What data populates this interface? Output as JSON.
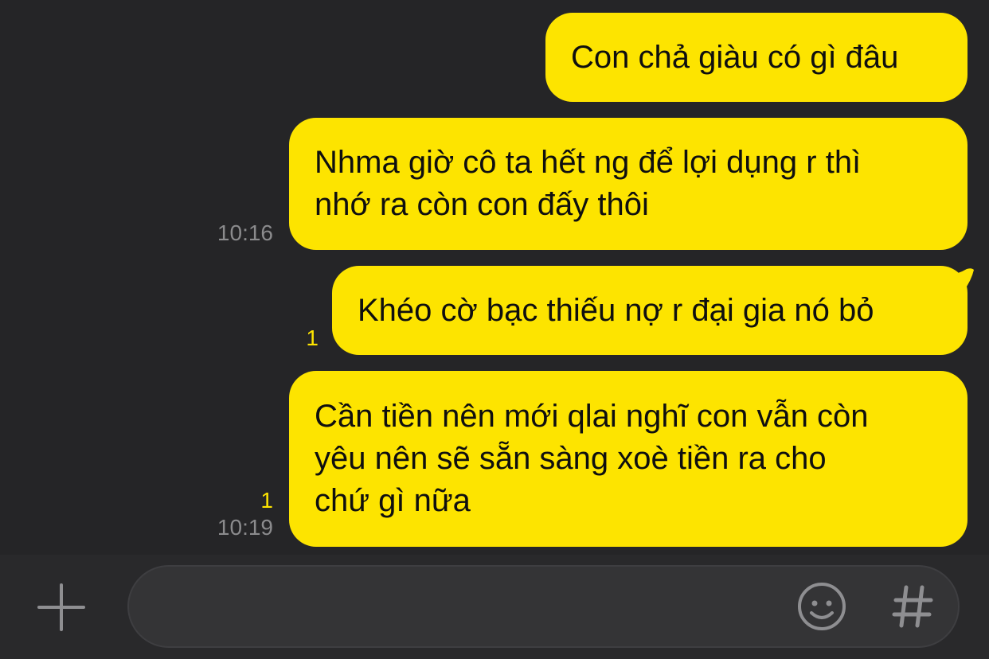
{
  "colors": {
    "background": "#252527",
    "bubble_outgoing": "#fde400",
    "bubble_text": "#0f0f0f",
    "timestamp": "#8b8b8d",
    "unread_count": "#fde400",
    "composer_bar": "#29292b",
    "input_field": "#343436",
    "icon": "#8e8e91"
  },
  "messages": [
    {
      "lines": [
        "Con chả giàu có gì đâu"
      ],
      "unread": "",
      "time": ""
    },
    {
      "lines": [
        "Nhma giờ cô ta hết ng để lợi dụng r thì",
        "nhớ ra còn con đấy thôi"
      ],
      "unread": "",
      "time": "10:16"
    },
    {
      "lines": [
        "Khéo cờ bạc thiếu nợ r đại gia nó bỏ"
      ],
      "unread": "1",
      "time": ""
    },
    {
      "lines": [
        "Cần tiền nên mới qlai nghĩ con vẫn còn",
        "yêu nên sẽ sẵn sàng xoè tiền ra cho",
        "chứ gì nữa"
      ],
      "unread": "1",
      "time": "10:19"
    }
  ],
  "composer": {
    "input_value": "",
    "input_placeholder": "",
    "icons": {
      "plus": "plus-icon",
      "emoji": "emoji-icon",
      "hashtag": "hashtag-icon"
    },
    "hash_glyph": "#"
  }
}
